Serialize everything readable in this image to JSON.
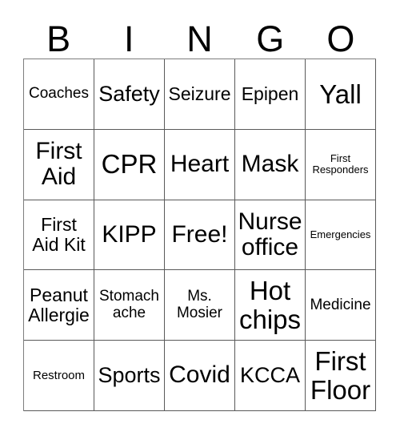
{
  "card": {
    "type": "bingo-card",
    "columns": 5,
    "rows": 5,
    "header_letters": [
      "B",
      "I",
      "N",
      "G",
      "O"
    ],
    "free_space_label": "Free!",
    "free_space_position": "N3",
    "colors": {
      "background": "#ffffff",
      "text": "#000000",
      "grid_line": "#5a5a5a"
    },
    "cells": [
      [
        {
          "text": "Coaches",
          "size": "sm"
        },
        {
          "text": "Safety",
          "size": "lg"
        },
        {
          "text": "Seizure",
          "size": "md"
        },
        {
          "text": "Epipen",
          "size": "md"
        },
        {
          "text": "Yall",
          "size": "xxl"
        }
      ],
      [
        {
          "text": "First\nAid",
          "size": "xl"
        },
        {
          "text": "CPR",
          "size": "xxl"
        },
        {
          "text": "Heart",
          "size": "xl"
        },
        {
          "text": "Mask",
          "size": "xl"
        },
        {
          "text": "First\nResponders",
          "size": "xxs"
        }
      ],
      [
        {
          "text": "First\nAid Kit",
          "size": "md"
        },
        {
          "text": "KIPP",
          "size": "xl"
        },
        {
          "text": "Free!",
          "size": "xl"
        },
        {
          "text": "Nurse\noffice",
          "size": "xl"
        },
        {
          "text": "Emergencies",
          "size": "xxs"
        }
      ],
      [
        {
          "text": "Peanut\nAllergie",
          "size": "md"
        },
        {
          "text": "Stomach\nache",
          "size": "sm"
        },
        {
          "text": "Ms.\nMosier",
          "size": "sm"
        },
        {
          "text": "Hot\nchips",
          "size": "xxl"
        },
        {
          "text": "Medicine",
          "size": "sm"
        }
      ],
      [
        {
          "text": "Restroom",
          "size": "xs"
        },
        {
          "text": "Sports",
          "size": "lg"
        },
        {
          "text": "Covid",
          "size": "xl"
        },
        {
          "text": "KCCA",
          "size": "lg"
        },
        {
          "text": "First\nFloor",
          "size": "xxl"
        }
      ]
    ]
  }
}
